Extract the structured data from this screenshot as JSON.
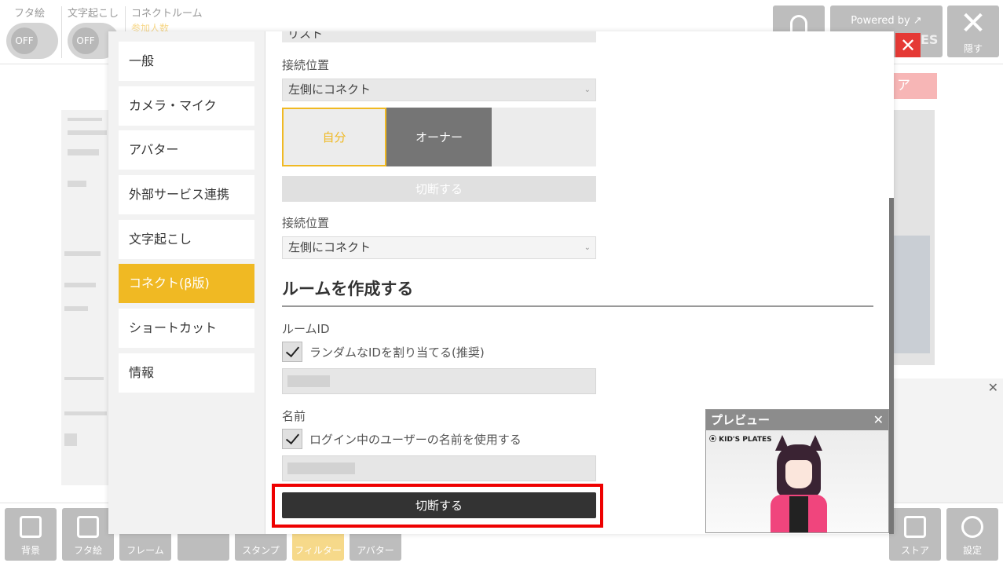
{
  "topbar": {
    "toggles": [
      {
        "label": "フタ絵",
        "state": "OFF"
      },
      {
        "label": "文字起こし",
        "state": "OFF"
      }
    ],
    "room": {
      "label": "コネクトルーム",
      "sub": "参加人数"
    },
    "powered_label": "Powered by",
    "hide_label": "隠す",
    "close_symbol": "✕",
    "es_text": "ES"
  },
  "background": {
    "pink_button_label": "ア",
    "side_panel_close": "✕"
  },
  "bottombar": {
    "buttons": [
      {
        "label": "背景"
      },
      {
        "label": "フタ絵"
      },
      {
        "label": "フレーム"
      },
      {
        "label": ""
      },
      {
        "label": "スタンプ"
      },
      {
        "label": "フィルター"
      },
      {
        "label": "アバター"
      },
      {
        "label": "ストア"
      },
      {
        "label": "設定"
      }
    ]
  },
  "settings": {
    "nav": [
      {
        "label": "一般"
      },
      {
        "label": "カメラ・マイク"
      },
      {
        "label": "アバター"
      },
      {
        "label": "外部サービス連携"
      },
      {
        "label": "文字起こし"
      },
      {
        "label": "コネクト(β版)",
        "active": true
      },
      {
        "label": "ショートカット"
      },
      {
        "label": "情報"
      }
    ],
    "content": {
      "top_cut_value": "リスト",
      "connect_position_label_1": "接続位置",
      "connect_position_value_1": "左側にコネクト",
      "segment": {
        "self": "自分",
        "owner": "オーナー"
      },
      "disconnect_disabled": "切断する",
      "connect_position_label_2": "接続位置",
      "connect_position_value_2": "左側にコネクト",
      "create_room_heading": "ルームを作成する",
      "room_id_label": "ルームID",
      "random_id_checkbox": "ランダムなIDを割り当てる(推奨)",
      "name_label": "名前",
      "use_login_name_checkbox": "ログイン中のユーザーの名前を使用する",
      "disconnect_button": "切断する",
      "chevron": "⌄"
    }
  },
  "preview": {
    "title": "プレビュー",
    "close_symbol": "✕",
    "brand": "⦿ KID'S PLATES"
  },
  "colors": {
    "accent": "#f0b923",
    "highlight": "#e00000",
    "dark_button": "#333333",
    "owner_segment": "#757575"
  }
}
